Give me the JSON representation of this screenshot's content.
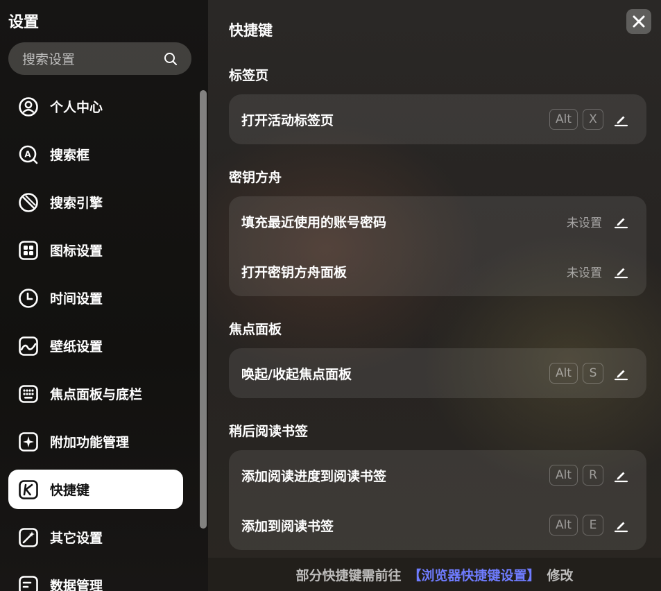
{
  "sidebar": {
    "title": "设置",
    "search_placeholder": "搜索设置",
    "items": [
      {
        "label": "个人中心",
        "icon": "user-circle-icon"
      },
      {
        "label": "搜索框",
        "icon": "search-box-icon"
      },
      {
        "label": "搜索引擎",
        "icon": "search-engine-icon"
      },
      {
        "label": "图标设置",
        "icon": "icon-grid-icon"
      },
      {
        "label": "时间设置",
        "icon": "clock-icon"
      },
      {
        "label": "壁纸设置",
        "icon": "wallpaper-icon"
      },
      {
        "label": "焦点面板与底栏",
        "icon": "keyboard-icon"
      },
      {
        "label": "附加功能管理",
        "icon": "sparkle-icon"
      },
      {
        "label": "快捷键",
        "icon": "shortcut-k-icon"
      },
      {
        "label": "其它设置",
        "icon": "magic-wand-icon"
      },
      {
        "label": "数据管理",
        "icon": "data-icon"
      }
    ],
    "active_index": 8
  },
  "main": {
    "title": "快捷键",
    "sections": [
      {
        "label": "标签页",
        "rows": [
          {
            "label": "打开活动标签页",
            "keys": [
              "Alt",
              "X"
            ]
          }
        ]
      },
      {
        "label": "密钥方舟",
        "rows": [
          {
            "label": "填充最近使用的账号密码",
            "unset": "未设置"
          },
          {
            "label": "打开密钥方舟面板",
            "unset": "未设置"
          }
        ]
      },
      {
        "label": "焦点面板",
        "rows": [
          {
            "label": "唤起/收起焦点面板",
            "keys": [
              "Alt",
              "S"
            ]
          }
        ]
      },
      {
        "label": "稍后阅读书签",
        "rows": [
          {
            "label": "添加阅读进度到阅读书签",
            "keys": [
              "Alt",
              "R"
            ]
          },
          {
            "label": "添加到阅读书签",
            "keys": [
              "Alt",
              "E"
            ]
          }
        ]
      }
    ],
    "footer": {
      "prefix": "部分快捷键需前往",
      "link": "【浏览器快捷键设置】",
      "suffix": "修改"
    }
  },
  "colors": {
    "link": "#6f7cff",
    "active_bg": "#ffffff"
  }
}
